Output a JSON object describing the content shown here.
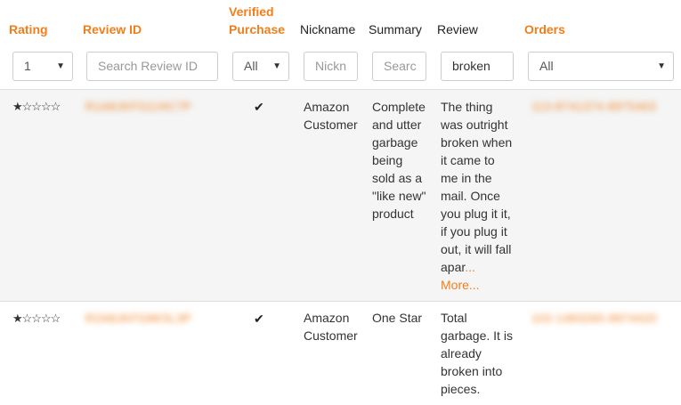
{
  "headers": {
    "rating": "Rating",
    "review_id": "Review ID",
    "verified_line1": "Verified",
    "verified_line2": "Purchase",
    "nickname": "Nickname",
    "summary": "Summary",
    "review": "Review",
    "orders": "Orders"
  },
  "filters": {
    "rating_value": "1",
    "review_id_placeholder": "Search Review ID",
    "verified_value": "All",
    "nickname_placeholder": "Nickn",
    "summary_placeholder": "Searc",
    "review_value": "broken",
    "orders_value": "All"
  },
  "rows": [
    {
      "stars": "★☆☆☆☆",
      "review_id": "R1A8JKFG2J4C7P",
      "verified": "✔",
      "nickname": [
        "Amazon",
        "Customer"
      ],
      "summary": [
        "Complete",
        "and utter",
        "garbage",
        "being",
        "sold as a",
        "\"like new\"",
        "product"
      ],
      "review": [
        "The thing",
        "was outright",
        "broken when",
        "it came to",
        "me in the",
        "mail. Once",
        "you plug it it,",
        "if you plug it",
        "out, it will fall",
        "apar"
      ],
      "review_ellipsis": "...",
      "review_more": "More...",
      "orders": "113-8741374-8975463"
    },
    {
      "stars": "★☆☆☆☆",
      "review_id": "R2A8JKFG8K5L3P",
      "verified": "✔",
      "nickname": [
        "Amazon",
        "Customer"
      ],
      "summary": [
        "One Star"
      ],
      "review": [
        "Total",
        "garbage. It is",
        "already",
        "broken into",
        "pieces."
      ],
      "orders": "102-1483265-8974420"
    }
  ]
}
